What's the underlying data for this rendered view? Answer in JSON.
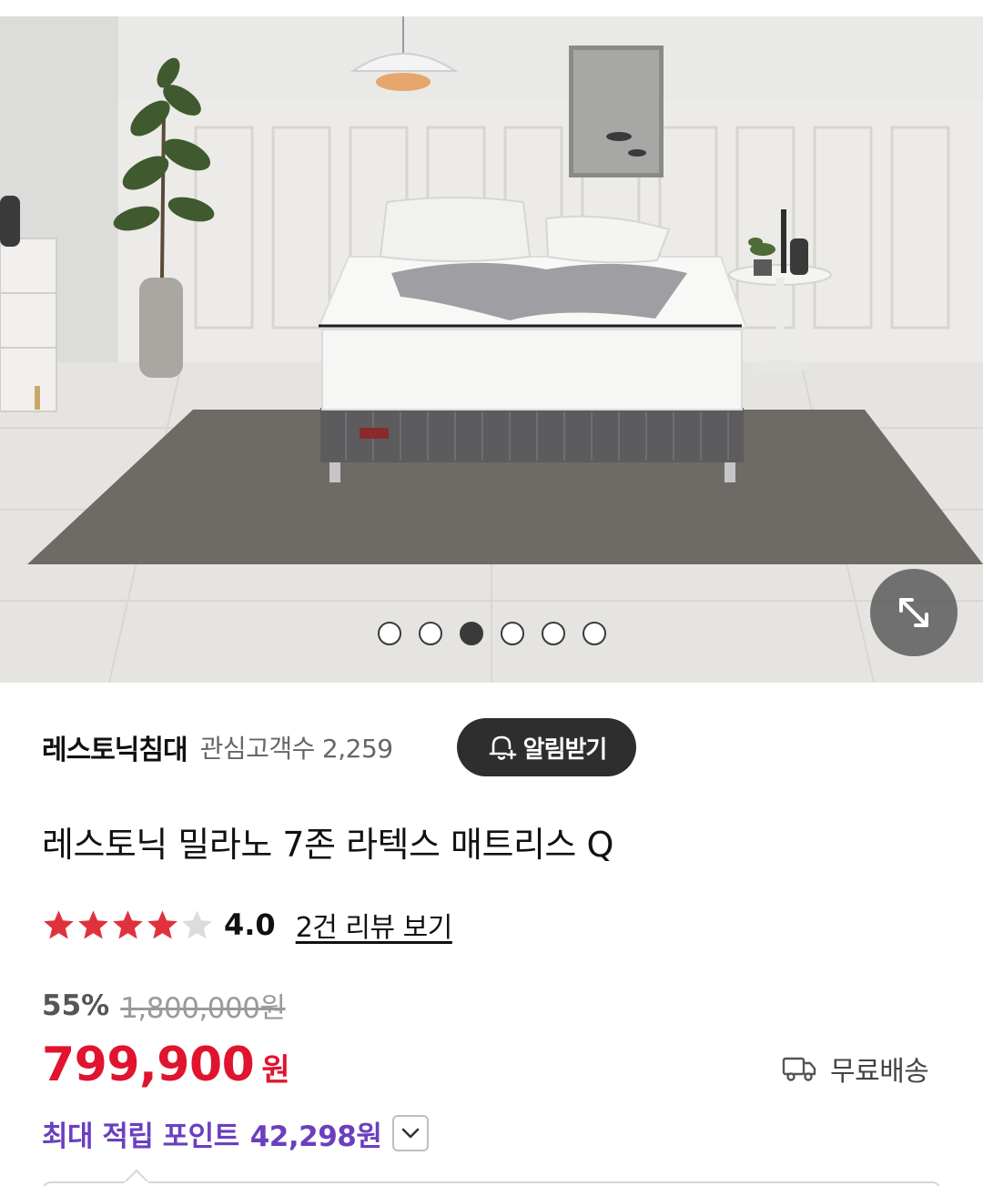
{
  "gallery": {
    "image_alt": "bedroom-mattress-photo",
    "total_slides": 6,
    "active_slide": 3,
    "expand_icon": "expand-arrows-icon"
  },
  "store": {
    "name": "레스토닉침대",
    "followers_label": "관심고객수",
    "followers_count": "2,259",
    "notify_label": "알림받기",
    "notify_icon": "bell-plus-icon"
  },
  "product": {
    "title": "레스토닉 밀라노 7존 라텍스 매트리스 Q"
  },
  "rating": {
    "score": "4.0",
    "stars_filled": 4,
    "stars_total": 5,
    "review_link": "2건 리뷰 보기",
    "star_color": "#e0323c"
  },
  "pricing": {
    "discount": "55%",
    "original_price": "1,800,000원",
    "sale_price": "799,900",
    "currency": "원",
    "sale_color": "#e0142e"
  },
  "shipping": {
    "label": "무료배송",
    "icon": "delivery-truck-icon"
  },
  "points": {
    "label": "최대 적립 포인트",
    "value": "42,298원",
    "toggle_icon": "chevron-down-icon",
    "color": "#6b3fc0"
  }
}
